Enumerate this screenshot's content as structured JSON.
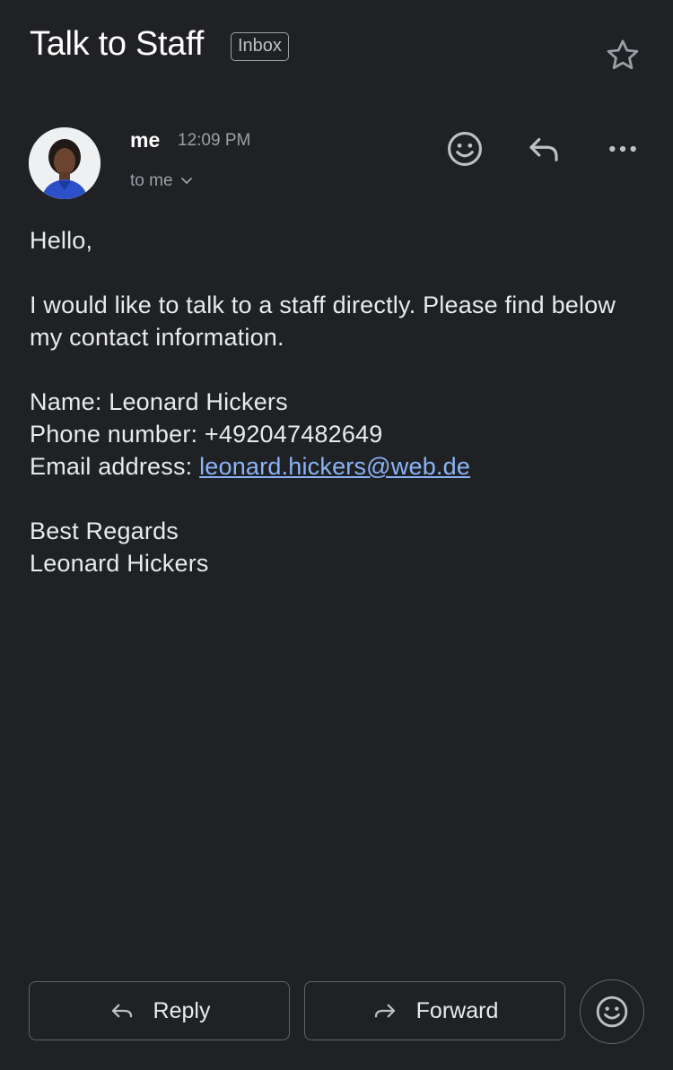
{
  "header": {
    "subject": "Talk to Staff",
    "label": "Inbox"
  },
  "message": {
    "sender": "me",
    "time": "12:09 PM",
    "recipient": "to me"
  },
  "body": {
    "greeting": "Hello,",
    "paragraph": "I would like to talk to a staff directly. Please find below my contact information.",
    "name_line": "Name: Leonard Hickers",
    "phone_line": "Phone number: +492047482649",
    "email_prefix": "Email address: ",
    "email": "leonard.hickers@web.de",
    "closing": "Best Regards",
    "signature": "Leonard Hickers"
  },
  "footer": {
    "reply_label": "Reply",
    "forward_label": "Forward"
  },
  "colors": {
    "background": "#202124",
    "link": "#8ab4f8",
    "muted": "#9aa0a6"
  },
  "icons": [
    "star-icon",
    "emoji-reaction-icon",
    "reply-icon",
    "more-options-icon",
    "chevron-down-icon",
    "forward-icon"
  ]
}
